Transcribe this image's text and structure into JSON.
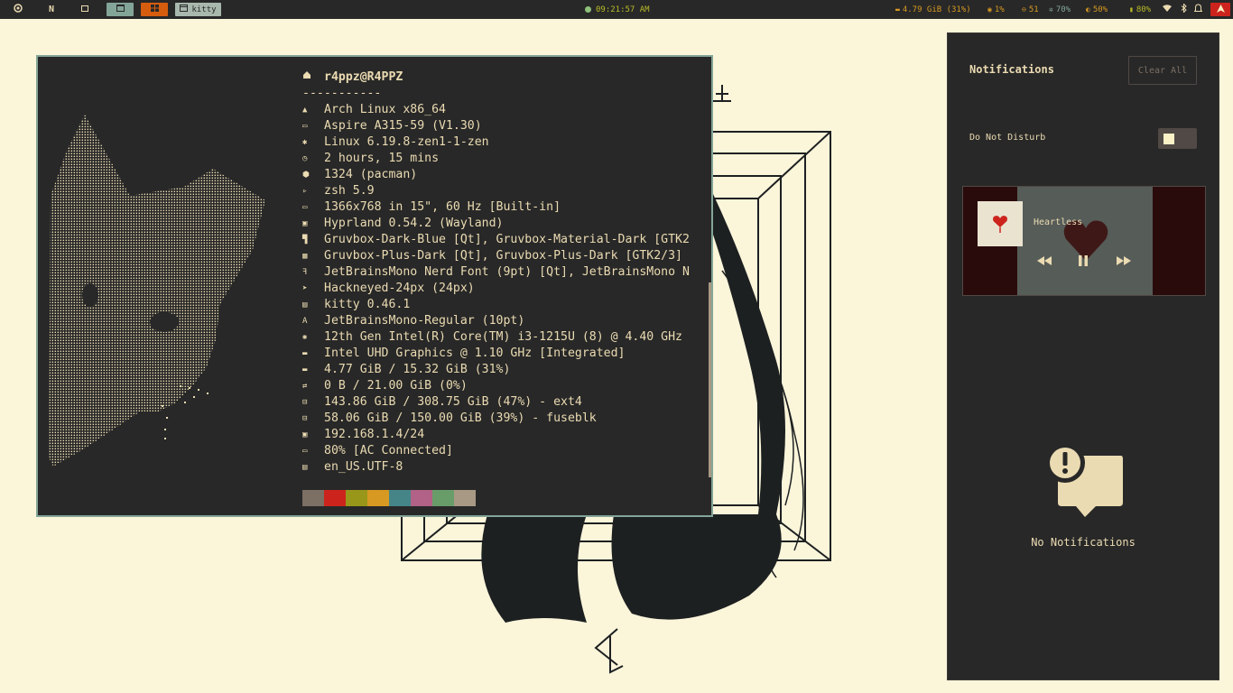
{
  "topbar": {
    "workspace_icons": [
      "arch-icon",
      "n-icon",
      "mail-icon",
      "window-icon",
      "grid-icon"
    ],
    "n_label": "N",
    "active_window_label": "kitty",
    "clock": "09:21:57 AM",
    "memory": "4.79 GiB (31%)",
    "cpu": "1%",
    "temperature": "51",
    "brightness": "70%",
    "volume": "50%",
    "battery": "80%",
    "colors": {
      "bar": "#282828",
      "workspace_active": "#83a598",
      "workspace_orange": "#d65d0e",
      "clock": "#b8bb26",
      "status": "#d79921"
    }
  },
  "terminal": {
    "header": "r4ppz@R4PPZ",
    "separator": "-----------",
    "info_lines": [
      {
        "icon": "arch-icon",
        "text": "Arch Linux x86_64"
      },
      {
        "icon": "laptop-icon",
        "text": "Aspire A315-59 (V1.30)"
      },
      {
        "icon": "gear-icon",
        "text": "Linux 6.19.8-zen1-1-zen"
      },
      {
        "icon": "clock-icon",
        "text": "2 hours, 15 mins"
      },
      {
        "icon": "package-icon",
        "text": "1324 (pacman)"
      },
      {
        "icon": "shell-icon",
        "text": "zsh 5.9"
      },
      {
        "icon": "monitor-icon",
        "text": "1366x768 in 15\", 60 Hz [Built-in]"
      },
      {
        "icon": "window-icon",
        "text": "Hyprland 0.54.2 (Wayland)"
      },
      {
        "icon": "paint-roller-icon",
        "text": "Gruvbox-Dark-Blue [Qt], Gruvbox-Material-Dark [GTK2"
      },
      {
        "icon": "icons-icon",
        "text": "Gruvbox-Plus-Dark [Qt], Gruvbox-Plus-Dark [GTK2/3]"
      },
      {
        "icon": "font-icon",
        "text": "JetBrainsMono Nerd Font (9pt) [Qt], JetBrainsMono N"
      },
      {
        "icon": "cursor-icon",
        "text": "Hackneyed-24px (24px)"
      },
      {
        "icon": "terminal-icon",
        "text": "kitty 0.46.1"
      },
      {
        "icon": "font-small-icon",
        "text": "JetBrainsMono-Regular (10pt)"
      },
      {
        "icon": "cpu-icon",
        "text": "12th Gen Intel(R) Core(TM) i3-1215U (8) @ 4.40 GHz"
      },
      {
        "icon": "gpu-icon",
        "text": "Intel UHD Graphics @ 1.10 GHz [Integrated]"
      },
      {
        "icon": "memory-icon",
        "text": "4.77 GiB / 15.32 GiB (31%)"
      },
      {
        "icon": "swap-icon",
        "text": "0 B / 21.00 GiB (0%)"
      },
      {
        "icon": "disk-icon",
        "text": "143.86 GiB / 308.75 GiB (47%) - ext4"
      },
      {
        "icon": "disk-icon",
        "text": "58.06 GiB / 150.00 GiB (39%) - fuseblk"
      },
      {
        "icon": "ip-icon",
        "text": "192.168.1.4/24"
      },
      {
        "icon": "battery-icon",
        "text": "80% [AC Connected]"
      },
      {
        "icon": "locale-icon",
        "text": "en_US.UTF-8"
      }
    ],
    "palette": [
      "#7c6f64",
      "#cc241d",
      "#98971a",
      "#d79921",
      "#458588",
      "#b16286",
      "#689d6a",
      "#a89984"
    ]
  },
  "notifications": {
    "title": "Notifications",
    "clear_all_label": "Clear All",
    "dnd_label": "Do Not Disturb",
    "dnd_enabled": false,
    "player": {
      "track_title": "Heartless",
      "prev_icon": "rewind-icon",
      "play_pause_icon": "pause-icon",
      "next_icon": "fast-forward-icon"
    },
    "empty_text": "No Notifications"
  }
}
